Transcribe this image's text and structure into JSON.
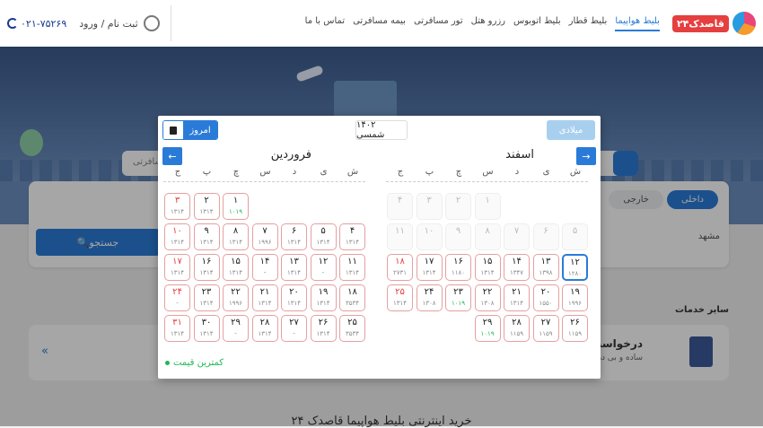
{
  "topbar": {
    "phone": "۰۲۱-۷۵۲۶۹",
    "login": "ثبت نام / ورود",
    "nav": [
      "بلیط هواپیما",
      "بلیط قطار",
      "بلیط اتوبوس",
      "رزرو هتل",
      "تور مسافرتی",
      "بیمه مسافرتی",
      "تماس با ما"
    ],
    "logo": "قاصدک۲۴"
  },
  "search": {
    "placeholder": "مسافرتی",
    "origin": "مشهد",
    "button": "جستجو",
    "tabs": [
      "داخلی",
      "خارجی"
    ]
  },
  "services": {
    "heading": "سایر خدمات",
    "title": "درخواست ویزا",
    "desc": "ساده و بی دردسر ویزا"
  },
  "footer_title": "خرید اینترنتی بلیط هواپیما قاصدک ۲۴",
  "datepicker": {
    "today": "امروز",
    "year": "۱۴۰۲ شمسی",
    "gregorian": "میلادی",
    "weekdays": [
      "ش",
      "ی",
      "د",
      "س",
      "چ",
      "پ",
      "ج"
    ],
    "legend": "کمترین قیمت",
    "months": [
      {
        "name": "اسفند",
        "start": 3,
        "days": [
          {
            "n": "۱",
            "p": "",
            "st": "past"
          },
          {
            "n": "۲",
            "p": "",
            "st": "past"
          },
          {
            "n": "۳",
            "p": "",
            "st": "past"
          },
          {
            "n": "۴",
            "p": "",
            "st": "past hol"
          },
          {
            "n": "۵",
            "p": "",
            "st": "past"
          },
          {
            "n": "۶",
            "p": "",
            "st": "past"
          },
          {
            "n": "۷",
            "p": "",
            "st": "past"
          },
          {
            "n": "۸",
            "p": "",
            "st": "past"
          },
          {
            "n": "۹",
            "p": "",
            "st": "past"
          },
          {
            "n": "۱۰",
            "p": "",
            "st": "past"
          },
          {
            "n": "۱۱",
            "p": "",
            "st": "past hol"
          },
          {
            "n": "۱۲",
            "p": "۱۲۸۰",
            "st": "sel"
          },
          {
            "n": "۱۳",
            "p": "۱۳۹۸",
            "st": ""
          },
          {
            "n": "۱۴",
            "p": "۱۳۴۷",
            "st": ""
          },
          {
            "n": "۱۵",
            "p": "۱۳۱۴",
            "st": ""
          },
          {
            "n": "۱۶",
            "p": "۱۱۸۰",
            "st": ""
          },
          {
            "n": "۱۷",
            "p": "۱۳۱۴",
            "st": ""
          },
          {
            "n": "۱۸",
            "p": "۲۷۳۱",
            "st": "hol"
          },
          {
            "n": "۱۹",
            "p": "۱۹۹۶",
            "st": ""
          },
          {
            "n": "۲۰",
            "p": "۱۵۵۰",
            "st": ""
          },
          {
            "n": "۲۱",
            "p": "۱۳۱۴",
            "st": ""
          },
          {
            "n": "۲۲",
            "p": "۱۳۰۸",
            "st": ""
          },
          {
            "n": "۲۳",
            "p": "۱۰۱۹",
            "st": "cheap"
          },
          {
            "n": "۲۴",
            "p": "۱۳۰۸",
            "st": ""
          },
          {
            "n": "۲۵",
            "p": "۱۳۱۴",
            "st": "hol"
          },
          {
            "n": "۲۶",
            "p": "۱۱۵۹",
            "st": ""
          },
          {
            "n": "۲۷",
            "p": "۱۱۵۹",
            "st": ""
          },
          {
            "n": "۲۸",
            "p": "۱۱۵۹",
            "st": ""
          },
          {
            "n": "۲۹",
            "p": "۱۰۱۹",
            "st": "cheap"
          }
        ]
      },
      {
        "name": "فروردین",
        "start": 4,
        "days": [
          {
            "n": "۱",
            "p": "۱۰۱۹",
            "st": "cheap"
          },
          {
            "n": "۲",
            "p": "۱۳۱۴",
            "st": ""
          },
          {
            "n": "۳",
            "p": "۱۳۱۴",
            "st": "hol"
          },
          {
            "n": "۴",
            "p": "۱۳۱۴",
            "st": ""
          },
          {
            "n": "۵",
            "p": "۱۳۱۴",
            "st": ""
          },
          {
            "n": "۶",
            "p": "۱۳۱۴",
            "st": ""
          },
          {
            "n": "۷",
            "p": "۱۹۹۶",
            "st": ""
          },
          {
            "n": "۸",
            "p": "۱۳۱۴",
            "st": ""
          },
          {
            "n": "۹",
            "p": "۱۳۱۴",
            "st": ""
          },
          {
            "n": "۱۰",
            "p": "۱۳۱۴",
            "st": "hol"
          },
          {
            "n": "۱۱",
            "p": "۱۳۱۴",
            "st": ""
          },
          {
            "n": "۱۲",
            "p": "-",
            "st": "cheap"
          },
          {
            "n": "۱۳",
            "p": "۱۳۱۴",
            "st": ""
          },
          {
            "n": "۱۴",
            "p": "-",
            "st": "cheap"
          },
          {
            "n": "۱۵",
            "p": "۱۳۱۴",
            "st": ""
          },
          {
            "n": "۱۶",
            "p": "۱۳۱۴",
            "st": ""
          },
          {
            "n": "۱۷",
            "p": "۱۳۱۴",
            "st": "hol"
          },
          {
            "n": "۱۸",
            "p": "۳۵۳۴",
            "st": ""
          },
          {
            "n": "۱۹",
            "p": "۱۳۱۴",
            "st": ""
          },
          {
            "n": "۲۰",
            "p": "۱۳۱۴",
            "st": ""
          },
          {
            "n": "۲۱",
            "p": "۱۳۱۴",
            "st": ""
          },
          {
            "n": "۲۲",
            "p": "۱۹۹۶",
            "st": ""
          },
          {
            "n": "۲۳",
            "p": "۱۳۱۴",
            "st": ""
          },
          {
            "n": "۲۴",
            "p": "-",
            "st": "hol"
          },
          {
            "n": "۲۵",
            "p": "۳۵۳۴",
            "st": ""
          },
          {
            "n": "۲۶",
            "p": "۱۳۱۴",
            "st": ""
          },
          {
            "n": "۲۷",
            "p": "-",
            "st": "cheap"
          },
          {
            "n": "۲۸",
            "p": "۱۳۱۴",
            "st": ""
          },
          {
            "n": "۲۹",
            "p": "-",
            "st": "cheap"
          },
          {
            "n": "۳۰",
            "p": "۱۳۱۴",
            "st": ""
          },
          {
            "n": "۳۱",
            "p": "۱۳۱۴",
            "st": "hol"
          }
        ]
      }
    ]
  }
}
